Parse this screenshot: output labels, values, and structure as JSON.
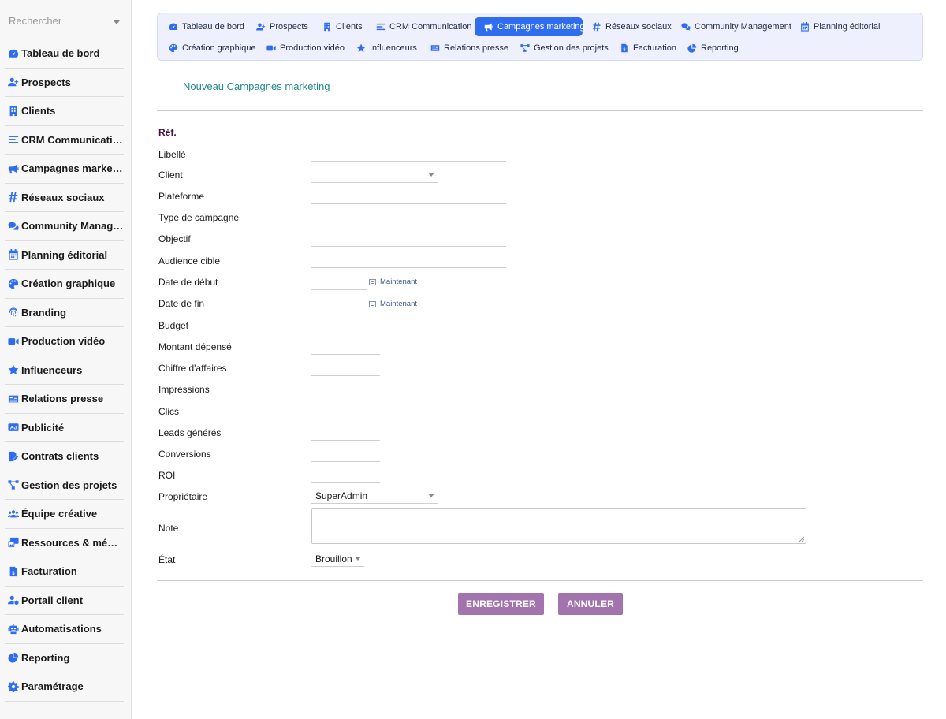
{
  "sidebar": {
    "search_placeholder": "Rechercher",
    "items": [
      {
        "label": "Tableau de bord",
        "icon": "gauge-icon"
      },
      {
        "label": "Prospects",
        "icon": "user-plus-icon"
      },
      {
        "label": "Clients",
        "icon": "building-icon"
      },
      {
        "label": "CRM Communication",
        "icon": "bars-icon"
      },
      {
        "label": "Campagnes marketing",
        "icon": "megaphone-icon"
      },
      {
        "label": "Réseaux sociaux",
        "icon": "hashtag-icon"
      },
      {
        "label": "Community Management",
        "icon": "comments-icon"
      },
      {
        "label": "Planning éditorial",
        "icon": "calendar-icon"
      },
      {
        "label": "Création graphique",
        "icon": "palette-icon"
      },
      {
        "label": "Branding",
        "icon": "fingerprint-icon"
      },
      {
        "label": "Production vidéo",
        "icon": "video-icon"
      },
      {
        "label": "Influenceurs",
        "icon": "star-icon"
      },
      {
        "label": "Relations presse",
        "icon": "newspaper-icon"
      },
      {
        "label": "Publicité",
        "icon": "ad-icon"
      },
      {
        "label": "Contrats clients",
        "icon": "file-signature-icon"
      },
      {
        "label": "Gestion des projets",
        "icon": "project-diagram-icon"
      },
      {
        "label": "Équipe créative",
        "icon": "users-icon"
      },
      {
        "label": "Ressources & médias",
        "icon": "photo-video-icon"
      },
      {
        "label": "Facturation",
        "icon": "invoice-icon"
      },
      {
        "label": "Portail client",
        "icon": "user-shield-icon"
      },
      {
        "label": "Automatisations",
        "icon": "robot-icon"
      },
      {
        "label": "Reporting",
        "icon": "pie-chart-icon"
      },
      {
        "label": "Paramétrage",
        "icon": "cog-icon"
      }
    ]
  },
  "topnav": {
    "row1": [
      {
        "label": "Tableau de bord",
        "icon": "gauge-icon"
      },
      {
        "label": "Prospects",
        "icon": "user-plus-icon"
      },
      {
        "label": "Clients",
        "icon": "building-icon"
      },
      {
        "label": "CRM Communication",
        "icon": "bars-icon"
      },
      {
        "label": "Campagnes marketing",
        "icon": "megaphone-icon",
        "active": true
      },
      {
        "label": "Réseaux sociaux",
        "icon": "hashtag-icon"
      },
      {
        "label": "Community Management",
        "icon": "comments-icon"
      },
      {
        "label": "Planning éditorial",
        "icon": "calendar-icon"
      }
    ],
    "row2": [
      {
        "label": "Création graphique",
        "icon": "palette-icon"
      },
      {
        "label": "Production vidéo",
        "icon": "video-icon"
      },
      {
        "label": "Influenceurs",
        "icon": "star-icon"
      },
      {
        "label": "Relations presse",
        "icon": "newspaper-icon"
      },
      {
        "label": "Gestion des projets",
        "icon": "project-diagram-icon"
      },
      {
        "label": "Facturation",
        "icon": "invoice-icon"
      },
      {
        "label": "Reporting",
        "icon": "pie-chart-icon"
      }
    ]
  },
  "page": {
    "title": "Nouveau Campagnes marketing"
  },
  "form": {
    "ref_label": "Réf.",
    "libelle_label": "Libellé",
    "client_label": "Client",
    "client_value": "",
    "plateforme_label": "Plateforme",
    "type_label": "Type de campagne",
    "objectif_label": "Objectif",
    "audience_label": "Audience cible",
    "date_debut_label": "Date de début",
    "date_fin_label": "Date de fin",
    "now_label": "Maintenant",
    "budget_label": "Budget",
    "montant_label": "Montant dépensé",
    "ca_label": "Chiffre d'affaires",
    "impressions_label": "Impressions",
    "clics_label": "Clics",
    "leads_label": "Leads générés",
    "conversions_label": "Conversions",
    "roi_label": "ROI",
    "proprietaire_label": "Propriétaire",
    "proprietaire_value": "SuperAdmin",
    "note_label": "Note",
    "etat_label": "État",
    "etat_value": "Brouillon"
  },
  "buttons": {
    "save": "ENREGISTRER",
    "cancel": "ANNULER"
  },
  "colors": {
    "icon_blue": "#2f6df0",
    "active_tab": "#2f6df0",
    "title_teal": "#218a8a",
    "button_purple": "#a273ad",
    "required_label": "#4a0e3a"
  }
}
